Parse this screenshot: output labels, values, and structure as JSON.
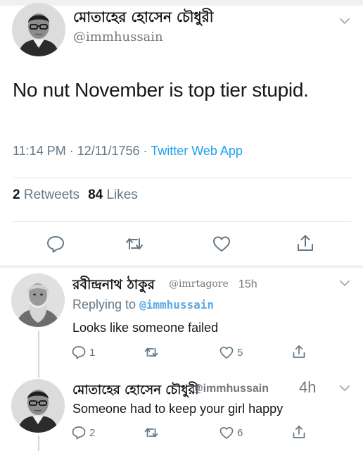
{
  "main_tweet": {
    "author_name": "মোতাহের হোসেন চৌধুরী",
    "author_handle": "@immhussain",
    "text": "No nut November is top tier stupid.",
    "time": "11:14 PM",
    "date": "12/11/1756",
    "source": "Twitter Web App",
    "retweets_count": "2",
    "retweets_label": "Retweets",
    "likes_count": "84",
    "likes_label": "Likes"
  },
  "replies": [
    {
      "author_name": "রবীন্দ্রনাথ ঠাকুর",
      "author_handle": "@imrtagore",
      "time": "15h",
      "replying_label": "Replying to",
      "replying_to": "@immhussain",
      "text": "Looks like someone failed",
      "reply_count": "1",
      "retweet_count": "",
      "like_count": "5"
    },
    {
      "author_name": "মোতাহের হোসেন চৌধুরী",
      "author_handle": "@immhussain",
      "time": "4h",
      "text": "Someone had to keep your girl happy",
      "reply_count": "2",
      "retweet_count": "",
      "like_count": "6"
    }
  ],
  "colors": {
    "accent": "#1da1f2",
    "mention": "#5fa9e3",
    "muted_text": "#657786",
    "divider": "#e1e8ed"
  },
  "icons": [
    "chevron-down-icon",
    "reply-icon",
    "retweet-icon",
    "like-icon",
    "share-icon"
  ]
}
